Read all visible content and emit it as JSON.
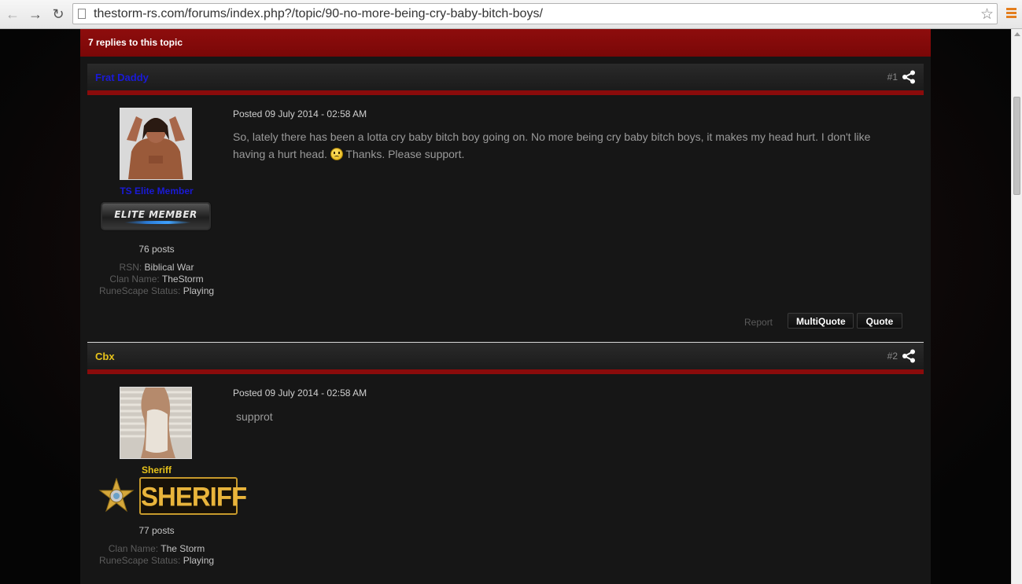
{
  "browser": {
    "url": "thestorm-rs.com/forums/index.php?/topic/90-no-more-being-cry-baby-bitch-boys/"
  },
  "topic": {
    "replies_text": "7 replies to this topic"
  },
  "posts": [
    {
      "author": "Frat Daddy",
      "author_color": "#1a1ad6",
      "post_number": "#1",
      "group_title": "TS Elite Member",
      "group_color": "#1a1ad6",
      "badge_text": "ELITE MEMBER",
      "post_count": "76 posts",
      "fields": [
        {
          "label": "RSN:",
          "value": "Biblical War"
        },
        {
          "label": "Clan Name:",
          "value": "TheStorm"
        },
        {
          "label": "RuneScape Status:",
          "value": "Playing"
        }
      ],
      "posted": "Posted 09 July 2014 - 02:58 AM",
      "body_line1": "So, lately there has been a lotta cry baby bitch boy going on. No more being cry baby bitch boys, it makes my head hurt. I don't like",
      "body_line2_before": "having a hurt head.",
      "body_line2_after": " Thanks. Please support.",
      "actions": {
        "report": "Report",
        "multiquote": "MultiQuote",
        "quote": "Quote"
      }
    },
    {
      "author": "Cbx",
      "author_color": "#e7c31b",
      "post_number": "#2",
      "group_title": "Sheriff",
      "group_color": "#e7c31b",
      "badge_text": "SHERIFF",
      "post_count": "77 posts",
      "fields": [
        {
          "label": "Clan Name:",
          "value": "The Storm"
        },
        {
          "label": "RuneScape Status:",
          "value": "Playing"
        }
      ],
      "posted": "Posted 09 July 2014 - 02:58 AM",
      "body": "supprot"
    }
  ],
  "icons": {
    "share": "share-icon",
    "smiley": "sad-smiley-icon",
    "star": "bookmark-star-icon"
  }
}
